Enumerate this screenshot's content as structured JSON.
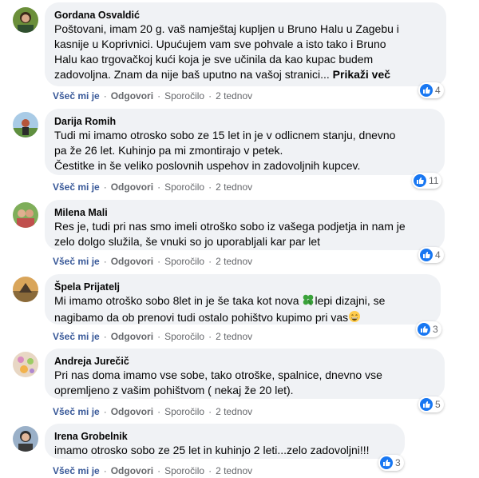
{
  "labels": {
    "like": "Všeč mi je",
    "reply": "Odgovori",
    "share": "Sporočilo",
    "sep": "·"
  },
  "colors": {
    "like_blue": "#1877f2",
    "bubble": "#f0f2f5",
    "meta": "#65676b"
  },
  "comments": [
    {
      "author": "Gordana Osvaldić",
      "text": "Poštovani, imam 20 g. vaš namještaj kupljen u Bruno Halu u Zagebu i\nkasnije u Koprivnici. Upućujem vam sve pohvale a isto tako i Bruno\nHalu kao trgovačkoj kući koja je sve učinila da kao kupac budem\nzadovoljna. Znam da nije baš uputno na vašoj stranici...",
      "more": "Prikaži več",
      "likes": "4",
      "time": "2 tednov"
    },
    {
      "author": "Darija Romih",
      "text": "Tudi mi imamo otrosko sobo ze 15 let in je v odlicnem stanju, dnevno\npa že 26 let. Kuhinjo pa mi zmontirajo v petek.\nČestitke in še veliko poslovnih uspehov in zadovoljnih kupcev.",
      "likes": "11",
      "time": "2 tednov"
    },
    {
      "author": "Milena Mali",
      "text": "Res je, tudi pri nas smo imeli otroško sobo iz vašega podjetja in nam je\nzelo dolgo služila, še vnuki so jo uporabljali kar par let",
      "likes": "4",
      "time": "2 tednov"
    },
    {
      "author": "Špela Prijatelj",
      "text_a": "Mi imamo otroško sobo 8let in je še taka kot nova ",
      "text_b": "lepi dizajni, se\nnagibamo da ob prenovi tudi ostalo pohištvo kupimo pri vas",
      "likes": "3",
      "time": "2 tednov"
    },
    {
      "author": "Andreja Jurečič",
      "text": "Pri nas doma imamo vse sobe, tako otroške, spalnice, dnevno vse\nopremljeno z vašim pohištvom ( nekaj že 20 let).",
      "likes": "5",
      "time": "2 tednov"
    },
    {
      "author": "Irena Grobelnik",
      "text": "imamo otrosko sobo ze 25 let in kuhinjo 2 leti...zelo zadovoljni!!!",
      "likes": "3",
      "time": "2 tednov"
    }
  ]
}
